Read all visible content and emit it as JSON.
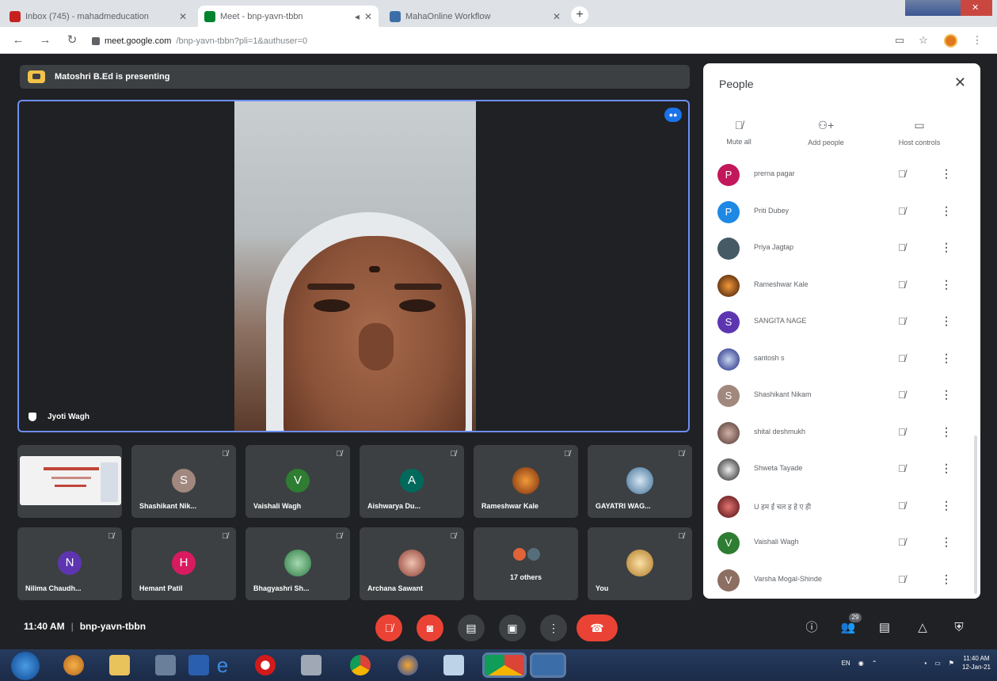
{
  "browser": {
    "tabs": [
      {
        "title": "Inbox (745) - mahadmeducation",
        "favicon_color": "#c5221f"
      },
      {
        "title": "Meet - bnp-yavn-tbbn",
        "favicon_color": "#00832d"
      },
      {
        "title": "MahaOnline Workflow",
        "favicon_color": "#3b6ea8"
      }
    ],
    "active_tab": 1,
    "url_host": "meet.google.com",
    "url_path": "/bnp-yavn-tbbn?pli=1&authuser=0"
  },
  "meet": {
    "presenting_banner": "Matoshri B.Ed is presenting",
    "main_speaker": "Jyoti Wagh",
    "tiles": [
      {
        "name": "",
        "type": "presentation"
      },
      {
        "name": "Shashikant Nik...",
        "initial": "S",
        "color": "#a1887f"
      },
      {
        "name": "Vaishali Wagh",
        "initial": "V",
        "color": "#2e7d32"
      },
      {
        "name": "Aishwarya Du...",
        "initial": "A",
        "color": "#00695c"
      },
      {
        "name": "Rameshwar Kale",
        "type": "image",
        "color": "#d06a1f"
      },
      {
        "name": "GAYATRI WAG...",
        "type": "image",
        "color": "#6f9fc4"
      },
      {
        "name": "Nilima Chaudh...",
        "initial": "N",
        "color": "#5e35b1"
      },
      {
        "name": "Hemant Patil",
        "initial": "H",
        "color": "#d81b60"
      },
      {
        "name": "Bhagyashri Sh...",
        "type": "image",
        "color": "#3f9a5a"
      },
      {
        "name": "Archana Sawant",
        "type": "image",
        "color": "#b3594a"
      },
      {
        "name": "17 others",
        "type": "others"
      },
      {
        "name": "You",
        "type": "image",
        "color": "#d9a441"
      }
    ]
  },
  "people_panel": {
    "title": "People",
    "actions": [
      {
        "label": "Mute all",
        "icon": "mic-off-icon"
      },
      {
        "label": "Add people",
        "icon": "person-add-icon"
      },
      {
        "label": "Host controls",
        "icon": "host-controls-icon"
      }
    ],
    "participants": [
      {
        "name": "prerna pagar",
        "initial": "P",
        "color": "#c2185b"
      },
      {
        "name": "Priti Dubey",
        "initial": "P",
        "color": "#1e88e5"
      },
      {
        "name": "Priya Jagtap",
        "initial": "",
        "color": "#455a64"
      },
      {
        "name": "Rameshwar Kale",
        "initial": "",
        "color": "#bf5a13"
      },
      {
        "name": "SANGITA NAGE",
        "initial": "S",
        "color": "#5e35b1"
      },
      {
        "name": "santosh s",
        "initial": "",
        "color": "#283593"
      },
      {
        "name": "Shashikant Nikam",
        "initial": "S",
        "color": "#a1887f"
      },
      {
        "name": "shital deshmukh",
        "initial": "",
        "color": "#6d4c41"
      },
      {
        "name": "Shweta Tayade",
        "initial": "",
        "color": "#37474f"
      },
      {
        "name": "U हम ई चल ह हे ए ही",
        "initial": "",
        "color": "#8e1b1b"
      },
      {
        "name": "Vaishali Wagh",
        "initial": "V",
        "color": "#2e7d32"
      },
      {
        "name": "Varsha Mogal-Shinde",
        "initial": "V",
        "color": "#8d6e63"
      }
    ]
  },
  "bottom": {
    "time": "11:40 AM",
    "meeting_code": "bnp-yavn-tbbn",
    "participant_count": "29"
  },
  "taskbar": {
    "clock_time": "11:40 AM",
    "clock_date": "12-Jan-21",
    "language": "EN"
  }
}
